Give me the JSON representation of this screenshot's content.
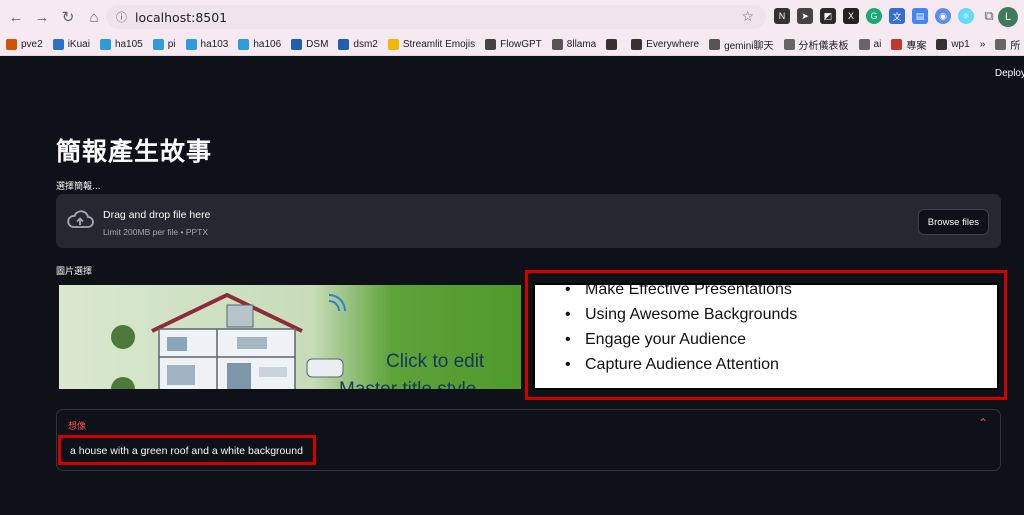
{
  "browser": {
    "url": "localhost:8501",
    "avatar_letter": "L",
    "bookmarks": [
      {
        "label": "pve2",
        "color": "#d35400"
      },
      {
        "label": "iKuai",
        "color": "#2b72c7"
      },
      {
        "label": "ha105",
        "color": "#2d9cdb"
      },
      {
        "label": "pi",
        "color": "#2d9cdb"
      },
      {
        "label": "ha103",
        "color": "#2d9cdb"
      },
      {
        "label": "ha106",
        "color": "#2d9cdb"
      },
      {
        "label": "DSM",
        "color": "#1f5fb0"
      },
      {
        "label": "dsm2",
        "color": "#1f5fb0"
      },
      {
        "label": "Streamlit Emojis",
        "color": "#f2b705"
      },
      {
        "label": "FlowGPT",
        "color": "#444444"
      },
      {
        "label": "8llama",
        "color": "#555555"
      },
      {
        "label": "",
        "color": "#333333"
      },
      {
        "label": "Everywhere",
        "color": "#333333"
      },
      {
        "label": "gemini聊天",
        "color": "#555555"
      },
      {
        "label": "分析儀表板",
        "color": "#666666"
      },
      {
        "label": "ai",
        "color": "#666666"
      },
      {
        "label": "專案",
        "color": "#c0392b"
      },
      {
        "label": "wp1",
        "color": "#333333"
      },
      {
        "label": "»",
        "color": ""
      },
      {
        "label": "所",
        "color": "#666666"
      }
    ]
  },
  "app": {
    "deploy_label": "Deploy",
    "title": "簡報產生故事",
    "upload_label": "選擇簡報...",
    "uploader": {
      "title": "Drag and drop file here",
      "subtitle": "Limit 200MB per file • PPTX",
      "button": "Browse files"
    },
    "image_select_label": "圖片選擇",
    "slide1": {
      "title_line1": "Click to edit",
      "title_line2": "Master title style"
    },
    "slide2": {
      "bullets": [
        "Make Effective Presentations",
        "Using Awesome Backgrounds",
        "Engage your Audience",
        "Capture Audience Attention"
      ]
    },
    "expander": {
      "label": "想像",
      "caption": "a house with a green roof and a white background"
    }
  },
  "colors": {
    "background": "#0e1117",
    "accent": "#ff4b4b",
    "highlight_border": "#d40000"
  }
}
